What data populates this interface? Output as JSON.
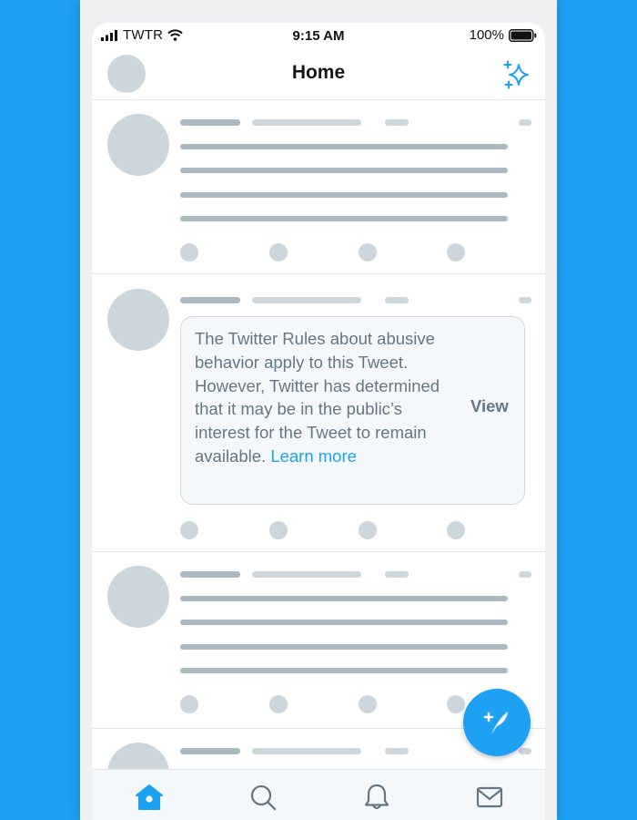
{
  "status_bar": {
    "carrier": "TWTR",
    "time": "9:15 AM",
    "battery": "100%"
  },
  "header": {
    "title": "Home",
    "icons": [
      "profile-avatar",
      "sparkle-icon"
    ]
  },
  "feed": {
    "notice": {
      "text": "The Twitter Rules about abusive behavior apply to this Tweet. However, Twitter has determined that it may be in the public’s interest for the Tweet to remain available.",
      "link_label": "Learn more",
      "action_label": "View"
    }
  },
  "tab_bar": {
    "items": [
      "home-icon",
      "search-icon",
      "bell-icon",
      "mail-icon"
    ],
    "active": "home-icon"
  },
  "colors": {
    "brand_blue": "#1da1f2",
    "placeholder_light": "#ccd6dd",
    "placeholder_dark": "#aab8c2",
    "notice_text": "#657786"
  },
  "compose": {
    "icon": "compose-icon"
  }
}
